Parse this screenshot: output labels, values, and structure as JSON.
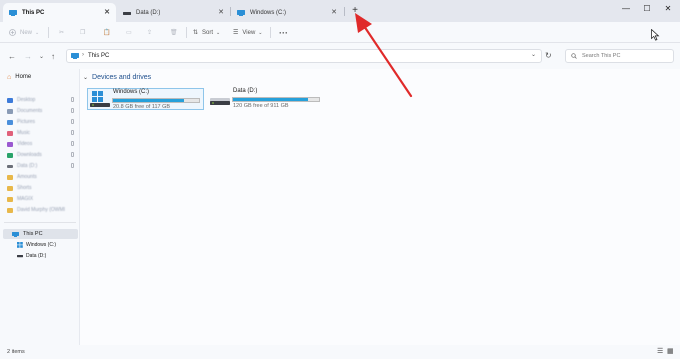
{
  "tabs": [
    {
      "label": "This PC",
      "icon": "this-pc-icon"
    },
    {
      "label": "Data (D:)",
      "icon": "drive-icon"
    },
    {
      "label": "Windows (C:)",
      "icon": "this-pc-icon"
    }
  ],
  "toolbar": {
    "new_label": "New",
    "sort_label": "Sort",
    "view_label": "View"
  },
  "address": {
    "crumb": "This PC",
    "search_placeholder": "Search This PC"
  },
  "sidebar": {
    "home": "Home",
    "quick_access": [
      {
        "label": "Desktop",
        "color": "#3d7bd9"
      },
      {
        "label": "Documents",
        "color": "#8a9bb5"
      },
      {
        "label": "Pictures",
        "color": "#4a8fdb"
      },
      {
        "label": "Music",
        "color": "#e0607a"
      },
      {
        "label": "Videos",
        "color": "#9b59d0"
      },
      {
        "label": "Downloads",
        "color": "#2aa36a"
      },
      {
        "label": "Data (D:)",
        "color": "#6b6f78"
      },
      {
        "label": "Amounts",
        "color": "#e8b84a"
      },
      {
        "label": "Shorts",
        "color": "#e8b84a"
      },
      {
        "label": "MAGIX",
        "color": "#e8b84a"
      },
      {
        "label": "David Murphy (OWMI",
        "color": "#e8b84a"
      }
    ],
    "this_pc": "This PC",
    "drives": [
      "Windows (C:)",
      "Data (D:)"
    ]
  },
  "main": {
    "section_title": "Devices and drives",
    "drives": [
      {
        "name": "Windows (C:)",
        "free_text": "20.8 GB free of 117 GB",
        "used_fraction": 0.822
      },
      {
        "name": "Data (D:)",
        "free_text": "120 GB free of 911 GB",
        "used_fraction": 0.868
      }
    ]
  },
  "status": {
    "items": "2 items"
  },
  "colors": {
    "accent": "#26a0da",
    "section_title": "#1e4e8c",
    "annotation_arrow": "#e02a2a"
  }
}
